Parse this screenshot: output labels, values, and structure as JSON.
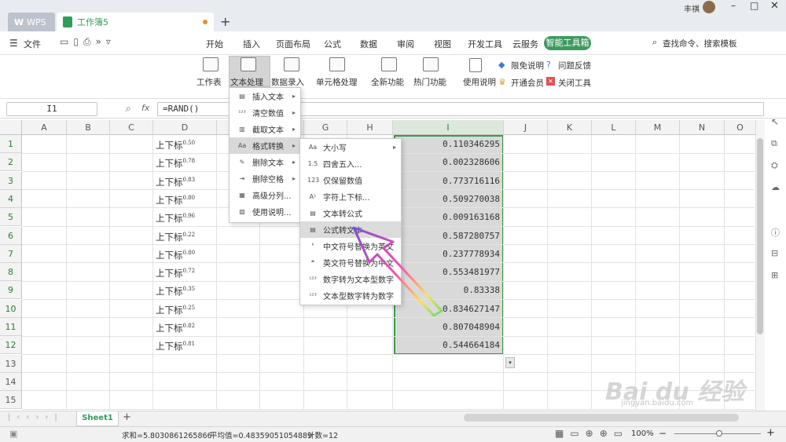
{
  "titlebar": {
    "tab_wps": "WPS",
    "tab_book": "工作簿5",
    "new_tab": "+",
    "user": "丰祺"
  },
  "menubar": {
    "file": "文件",
    "items": [
      "开始",
      "插入",
      "页面布局",
      "公式",
      "数据",
      "审阅",
      "视图",
      "开发工具",
      "云服务"
    ],
    "active": "智能工具箱",
    "search": "查找命令、搜索模板"
  },
  "ribbon": {
    "left_groups": [
      "工作表",
      "文本处理",
      "数据录入",
      "单元格处理",
      "全新功能",
      "热门功能",
      "使用说明"
    ],
    "right_links": [
      "限免说明",
      "问题反馈",
      "开通会员",
      "关闭工具"
    ]
  },
  "formula": {
    "namebox": "I1",
    "fx": "fx",
    "content": "=RAND()"
  },
  "columns": [
    "A",
    "B",
    "C",
    "D",
    "E",
    "F",
    "G",
    "H",
    "I",
    "J",
    "K",
    "L",
    "M",
    "N",
    "O"
  ],
  "rows": [
    "1",
    "2",
    "3",
    "4",
    "5",
    "6",
    "7",
    "8",
    "9",
    "10",
    "11",
    "12",
    "13",
    "14",
    "15"
  ],
  "column_d": {
    "prefix": "上下标",
    "values": [
      "0.50",
      "0.78",
      "0.83",
      "0.80",
      "0.96",
      "0.22",
      "0.80",
      "0.72",
      "0.35",
      "0.25",
      "0.82",
      "0.81"
    ]
  },
  "column_i": [
    "0.110346295",
    "0.002328606",
    "0.773716116",
    "0.509270038",
    "0.009163168",
    "0.587280757",
    "0.237778934",
    "0.553481977",
    "0.83338",
    "0.834627147",
    "0.807048904",
    "0.544664184"
  ],
  "submenu1": [
    "插入文本",
    "清空数值",
    "截取文本",
    "格式转换",
    "删除文本",
    "删除空格",
    "高级分列...",
    "使用说明..."
  ],
  "submenu2": [
    "大小写",
    "四舍五入...",
    "仅保留数值",
    "字符上下标...",
    "文本转公式",
    "公式转文本",
    "中文符号替换为英文",
    "英文符号替换为中文",
    "数字转为文本型数字",
    "文本型数字转为数字"
  ],
  "sheet": {
    "tab": "Sheet1",
    "add": "+"
  },
  "status": {
    "sum": "求和=5.8030861265866",
    "avg": "平均值=0.48359051054889",
    "count": "计数=12",
    "zoom": "100%"
  },
  "watermark": {
    "brand": "Bai du 经验",
    "url": "jingyan.baidu.com"
  },
  "colors": {
    "accent": "#3c9a47",
    "active_tab": "#3c9a5f"
  }
}
